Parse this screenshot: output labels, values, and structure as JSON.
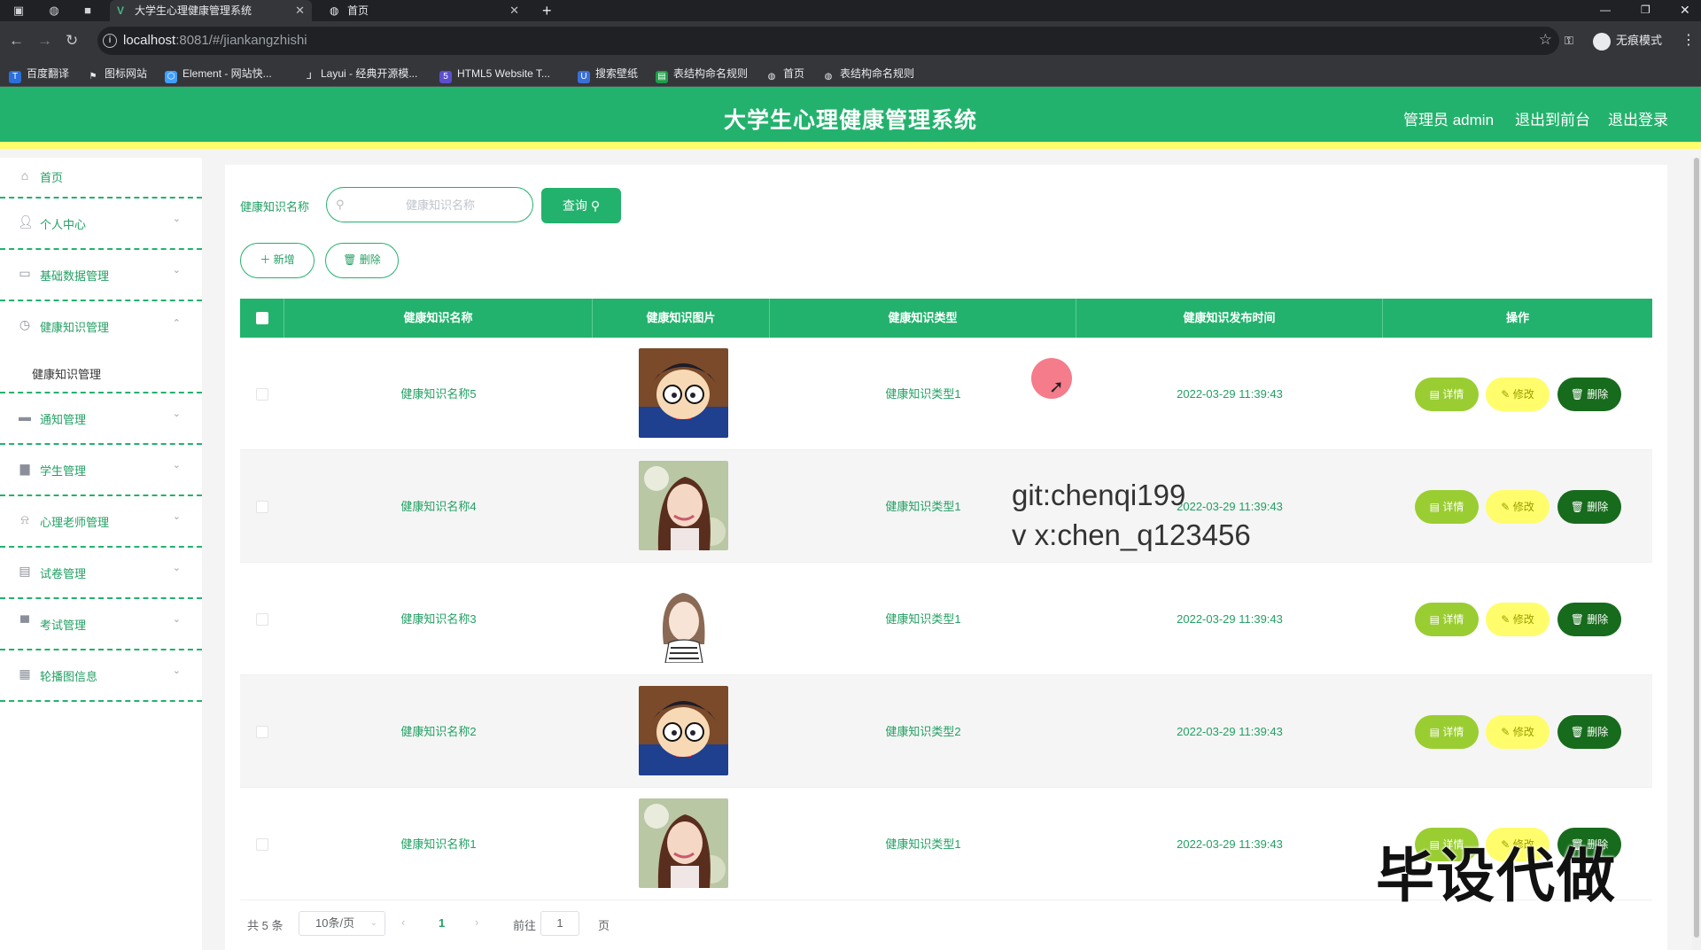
{
  "browser": {
    "tabs": [
      {
        "title": "大学生心理健康管理系统",
        "active": true,
        "favicon": "V"
      },
      {
        "title": "首页",
        "active": false,
        "favicon": "globe-icon"
      }
    ],
    "url_host": "localhost",
    "url_path": ":8081/#/jiankangzhishi",
    "profile_label": "无痕模式",
    "bookmarks": [
      "百度翻译",
      "图标网站",
      "Element - 网站快...",
      "Layui - 经典开源模...",
      "HTML5 Website T...",
      "搜索壁纸",
      "表结构命名规则",
      "首页",
      "表结构命名规则"
    ]
  },
  "header": {
    "title": "大学生心理健康管理系统",
    "user": "管理员 admin",
    "to_front": "退出到前台",
    "logout": "退出登录",
    "colors": {
      "primary": "#23b26d",
      "accent_bar": "#fffd6b"
    }
  },
  "sidebar": {
    "home": "首页",
    "items": [
      {
        "label": "个人中心",
        "icon": "user-icon"
      },
      {
        "label": "基础数据管理",
        "icon": "chat-icon"
      },
      {
        "label": "健康知识管理",
        "icon": "clock-icon",
        "expanded": true,
        "sub": "健康知识管理"
      },
      {
        "label": "通知管理",
        "icon": "briefcase-icon"
      },
      {
        "label": "学生管理",
        "icon": "monitor-icon"
      },
      {
        "label": "心理老师管理",
        "icon": "bell-icon"
      },
      {
        "label": "试卷管理",
        "icon": "document-icon"
      },
      {
        "label": "考试管理",
        "icon": "screen-icon"
      },
      {
        "label": "轮播图信息",
        "icon": "grid-icon"
      }
    ]
  },
  "search": {
    "label": "健康知识名称",
    "placeholder": "健康知识名称",
    "query_button": "查询",
    "add_button": "新增",
    "delete_button": "删除"
  },
  "table": {
    "columns": [
      "健康知识名称",
      "健康知识图片",
      "健康知识类型",
      "健康知识发布时间",
      "操作"
    ],
    "rows": [
      {
        "name": "健康知识名称5",
        "image": "cartoon-boy",
        "type": "健康知识类型1",
        "time": "2022-03-29 11:39:43"
      },
      {
        "name": "健康知识名称4",
        "image": "photo-girl",
        "type": "健康知识类型1",
        "time": "2022-03-29 11:39:43"
      },
      {
        "name": "健康知识名称3",
        "image": "sketch-girl",
        "type": "健康知识类型1",
        "time": "2022-03-29 11:39:43"
      },
      {
        "name": "健康知识名称2",
        "image": "cartoon-boy",
        "type": "健康知识类型2",
        "time": "2022-03-29 11:39:43"
      },
      {
        "name": "健康知识名称1",
        "image": "photo-girl",
        "type": "健康知识类型1",
        "time": "2022-03-29 11:39:43"
      }
    ],
    "actions": {
      "detail": "详情",
      "edit": "修改",
      "delete": "删除"
    }
  },
  "pagination": {
    "total": "共 5 条",
    "page_size": "10条/页",
    "current_page": "1",
    "goto_label": "前往",
    "goto_value": "1",
    "page_unit": "页"
  },
  "overlays": {
    "line1": "git:chenqi199",
    "line2": "v x:chen_q123456",
    "stamp": "毕设代做"
  }
}
